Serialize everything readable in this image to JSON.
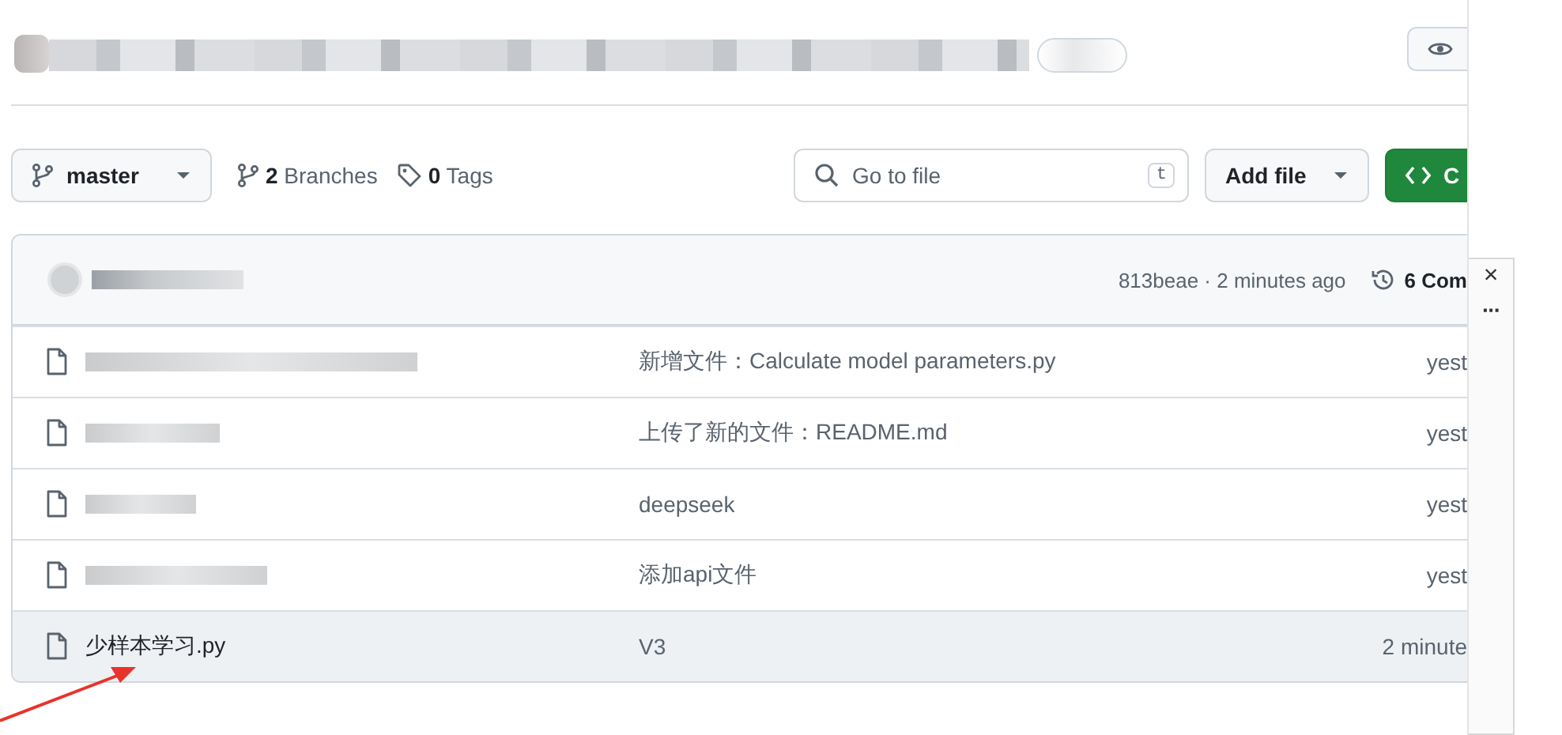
{
  "branch_selector": {
    "label": "master"
  },
  "branches": "**2** Branches",
  "tags": "**0** Tags",
  "search": {
    "placeholder": "Go to file",
    "shortcut": "t"
  },
  "add_file_button": "Add file",
  "code_button": "C",
  "latest_commit": {
    "info": "813beae · 2 minutes ago",
    "commits": "6 Com"
  },
  "files": [
    {
      "redacted": true,
      "message": "新增文件：Calculate model parameters.py",
      "time": "yest",
      "highlighted": false
    },
    {
      "redacted": true,
      "message": "上传了新的文件：README.md",
      "time": "yest",
      "highlighted": false
    },
    {
      "redacted": true,
      "message": "deepseek",
      "time": "yest",
      "highlighted": false
    },
    {
      "redacted": true,
      "message": "添加api文件",
      "time": "yest",
      "highlighted": false
    },
    {
      "redacted": false,
      "name": "少样本学习.py",
      "message": "V3",
      "time": "2 minute",
      "highlighted": true
    }
  ],
  "side_popup": {
    "close": "×",
    "more": "···"
  }
}
